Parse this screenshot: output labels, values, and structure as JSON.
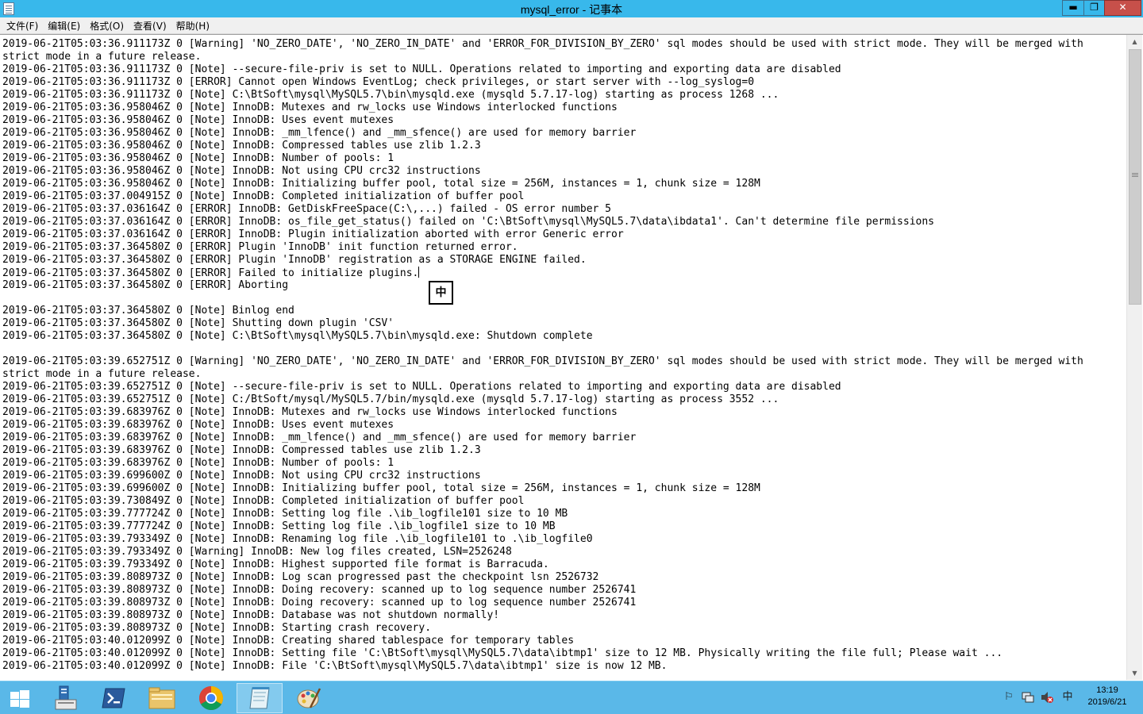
{
  "window": {
    "title": "mysql_error - 记事本",
    "minimize_glyph": "▬",
    "maximize_glyph": "❐",
    "close_glyph": "✕"
  },
  "menu": {
    "items": [
      "文件(F)",
      "编辑(E)",
      "格式(O)",
      "查看(V)",
      "帮助(H)"
    ]
  },
  "editor": {
    "lines": [
      "2019-06-21T05:03:36.911173Z 0 [Warning] 'NO_ZERO_DATE', 'NO_ZERO_IN_DATE' and 'ERROR_FOR_DIVISION_BY_ZERO' sql modes should be used with strict mode. They will be merged with",
      "strict mode in a future release.",
      "2019-06-21T05:03:36.911173Z 0 [Note] --secure-file-priv is set to NULL. Operations related to importing and exporting data are disabled",
      "2019-06-21T05:03:36.911173Z 0 [ERROR] Cannot open Windows EventLog; check privileges, or start server with --log_syslog=0",
      "2019-06-21T05:03:36.911173Z 0 [Note] C:\\BtSoft\\mysql\\MySQL5.7\\bin\\mysqld.exe (mysqld 5.7.17-log) starting as process 1268 ...",
      "2019-06-21T05:03:36.958046Z 0 [Note] InnoDB: Mutexes and rw_locks use Windows interlocked functions",
      "2019-06-21T05:03:36.958046Z 0 [Note] InnoDB: Uses event mutexes",
      "2019-06-21T05:03:36.958046Z 0 [Note] InnoDB: _mm_lfence() and _mm_sfence() are used for memory barrier",
      "2019-06-21T05:03:36.958046Z 0 [Note] InnoDB: Compressed tables use zlib 1.2.3",
      "2019-06-21T05:03:36.958046Z 0 [Note] InnoDB: Number of pools: 1",
      "2019-06-21T05:03:36.958046Z 0 [Note] InnoDB: Not using CPU crc32 instructions",
      "2019-06-21T05:03:36.958046Z 0 [Note] InnoDB: Initializing buffer pool, total size = 256M, instances = 1, chunk size = 128M",
      "2019-06-21T05:03:37.004915Z 0 [Note] InnoDB: Completed initialization of buffer pool",
      "2019-06-21T05:03:37.036164Z 0 [ERROR] InnoDB: GetDiskFreeSpace(C:\\,...) failed - OS error number 5",
      "2019-06-21T05:03:37.036164Z 0 [ERROR] InnoDB: os_file_get_status() failed on 'C:\\BtSoft\\mysql\\MySQL5.7\\data\\ibdata1'. Can't determine file permissions",
      "2019-06-21T05:03:37.036164Z 0 [ERROR] InnoDB: Plugin initialization aborted with error Generic error",
      "2019-06-21T05:03:37.364580Z 0 [ERROR] Plugin 'InnoDB' init function returned error.",
      "2019-06-21T05:03:37.364580Z 0 [ERROR] Plugin 'InnoDB' registration as a STORAGE ENGINE failed.",
      "2019-06-21T05:03:37.364580Z 0 [ERROR] Failed to initialize plugins.",
      "2019-06-21T05:03:37.364580Z 0 [ERROR] Aborting",
      "",
      "2019-06-21T05:03:37.364580Z 0 [Note] Binlog end",
      "2019-06-21T05:03:37.364580Z 0 [Note] Shutting down plugin 'CSV'",
      "2019-06-21T05:03:37.364580Z 0 [Note] C:\\BtSoft\\mysql\\MySQL5.7\\bin\\mysqld.exe: Shutdown complete",
      "",
      "2019-06-21T05:03:39.652751Z 0 [Warning] 'NO_ZERO_DATE', 'NO_ZERO_IN_DATE' and 'ERROR_FOR_DIVISION_BY_ZERO' sql modes should be used with strict mode. They will be merged with",
      "strict mode in a future release.",
      "2019-06-21T05:03:39.652751Z 0 [Note] --secure-file-priv is set to NULL. Operations related to importing and exporting data are disabled",
      "2019-06-21T05:03:39.652751Z 0 [Note] C:/BtSoft/mysql/MySQL5.7/bin/mysqld.exe (mysqld 5.7.17-log) starting as process 3552 ...",
      "2019-06-21T05:03:39.683976Z 0 [Note] InnoDB: Mutexes and rw_locks use Windows interlocked functions",
      "2019-06-21T05:03:39.683976Z 0 [Note] InnoDB: Uses event mutexes",
      "2019-06-21T05:03:39.683976Z 0 [Note] InnoDB: _mm_lfence() and _mm_sfence() are used for memory barrier",
      "2019-06-21T05:03:39.683976Z 0 [Note] InnoDB: Compressed tables use zlib 1.2.3",
      "2019-06-21T05:03:39.683976Z 0 [Note] InnoDB: Number of pools: 1",
      "2019-06-21T05:03:39.699600Z 0 [Note] InnoDB: Not using CPU crc32 instructions",
      "2019-06-21T05:03:39.699600Z 0 [Note] InnoDB: Initializing buffer pool, total size = 256M, instances = 1, chunk size = 128M",
      "2019-06-21T05:03:39.730849Z 0 [Note] InnoDB: Completed initialization of buffer pool",
      "2019-06-21T05:03:39.777724Z 0 [Note] InnoDB: Setting log file .\\ib_logfile101 size to 10 MB",
      "2019-06-21T05:03:39.777724Z 0 [Note] InnoDB: Setting log file .\\ib_logfile1 size to 10 MB",
      "2019-06-21T05:03:39.793349Z 0 [Note] InnoDB: Renaming log file .\\ib_logfile101 to .\\ib_logfile0",
      "2019-06-21T05:03:39.793349Z 0 [Warning] InnoDB: New log files created, LSN=2526248",
      "2019-06-21T05:03:39.793349Z 0 [Note] InnoDB: Highest supported file format is Barracuda.",
      "2019-06-21T05:03:39.808973Z 0 [Note] InnoDB: Log scan progressed past the checkpoint lsn 2526732",
      "2019-06-21T05:03:39.808973Z 0 [Note] InnoDB: Doing recovery: scanned up to log sequence number 2526741",
      "2019-06-21T05:03:39.808973Z 0 [Note] InnoDB: Doing recovery: scanned up to log sequence number 2526741",
      "2019-06-21T05:03:39.808973Z 0 [Note] InnoDB: Database was not shutdown normally!",
      "2019-06-21T05:03:39.808973Z 0 [Note] InnoDB: Starting crash recovery.",
      "2019-06-21T05:03:40.012099Z 0 [Note] InnoDB: Creating shared tablespace for temporary tables",
      "2019-06-21T05:03:40.012099Z 0 [Note] InnoDB: Setting file 'C:\\BtSoft\\mysql\\MySQL5.7\\data\\ibtmp1' size to 12 MB. Physically writing the file full; Please wait ...",
      "2019-06-21T05:03:40.012099Z 0 [Note] InnoDB: File 'C:\\BtSoft\\mysql\\MySQL5.7\\data\\ibtmp1' size is now 12 MB."
    ],
    "caret_line_index": 18,
    "ime_indicator": "中"
  },
  "taskbar": {
    "tray_ime": "中",
    "clock_time": "13:19",
    "clock_date": "2019/6/21"
  },
  "colors": {
    "titlebar": "#38b8eb",
    "close_button": "#c7504a",
    "taskbar": "#5ab8e8"
  }
}
